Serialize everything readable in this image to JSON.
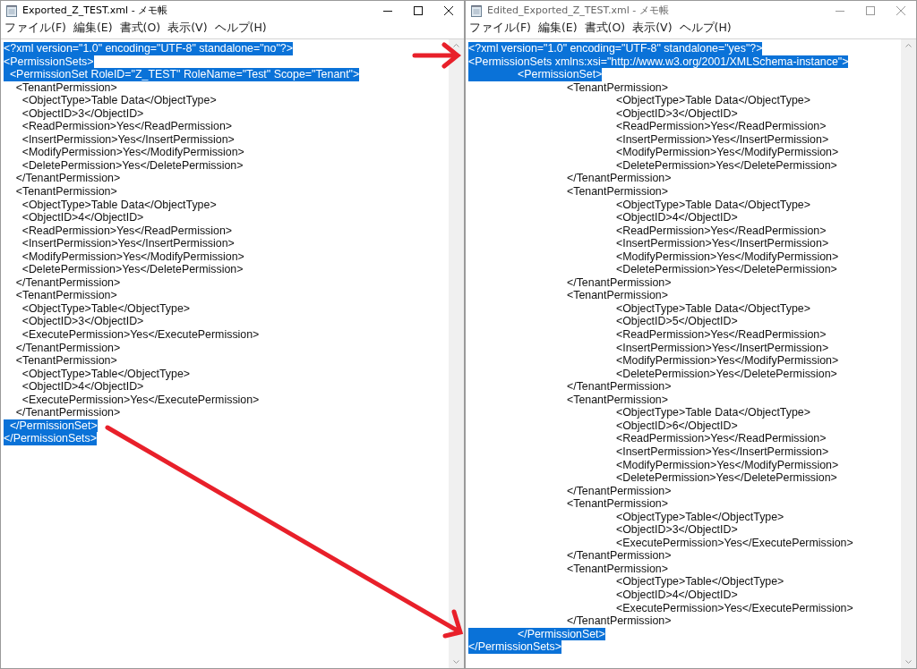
{
  "windows": [
    {
      "title": "Exported_Z_TEST.xml - メモ帳",
      "active": true,
      "menu": [
        "ファイル(F)",
        "編集(E)",
        "書式(O)",
        "表示(V)",
        "ヘルプ(H)"
      ],
      "lines": [
        {
          "text": "<?xml version=\"1.0\" encoding=\"UTF-8\" standalone=\"no\"?>",
          "selected": true
        },
        {
          "text": "<PermissionSets>",
          "selected": true
        },
        {
          "text": "  <PermissionSet RoleID=\"Z_TEST\" RoleName=\"Test\" Scope=\"Tenant\">",
          "selected": true
        },
        {
          "text": "    <TenantPermission>",
          "selected": false
        },
        {
          "text": "      <ObjectType>Table Data</ObjectType>",
          "selected": false
        },
        {
          "text": "      <ObjectID>3</ObjectID>",
          "selected": false
        },
        {
          "text": "      <ReadPermission>Yes</ReadPermission>",
          "selected": false
        },
        {
          "text": "      <InsertPermission>Yes</InsertPermission>",
          "selected": false
        },
        {
          "text": "      <ModifyPermission>Yes</ModifyPermission>",
          "selected": false
        },
        {
          "text": "      <DeletePermission>Yes</DeletePermission>",
          "selected": false
        },
        {
          "text": "    </TenantPermission>",
          "selected": false
        },
        {
          "text": "    <TenantPermission>",
          "selected": false
        },
        {
          "text": "      <ObjectType>Table Data</ObjectType>",
          "selected": false
        },
        {
          "text": "      <ObjectID>4</ObjectID>",
          "selected": false
        },
        {
          "text": "      <ReadPermission>Yes</ReadPermission>",
          "selected": false
        },
        {
          "text": "      <InsertPermission>Yes</InsertPermission>",
          "selected": false
        },
        {
          "text": "      <ModifyPermission>Yes</ModifyPermission>",
          "selected": false
        },
        {
          "text": "      <DeletePermission>Yes</DeletePermission>",
          "selected": false
        },
        {
          "text": "    </TenantPermission>",
          "selected": false
        },
        {
          "text": "    <TenantPermission>",
          "selected": false
        },
        {
          "text": "      <ObjectType>Table</ObjectType>",
          "selected": false
        },
        {
          "text": "      <ObjectID>3</ObjectID>",
          "selected": false
        },
        {
          "text": "      <ExecutePermission>Yes</ExecutePermission>",
          "selected": false
        },
        {
          "text": "    </TenantPermission>",
          "selected": false
        },
        {
          "text": "    <TenantPermission>",
          "selected": false
        },
        {
          "text": "      <ObjectType>Table</ObjectType>",
          "selected": false
        },
        {
          "text": "      <ObjectID>4</ObjectID>",
          "selected": false
        },
        {
          "text": "      <ExecutePermission>Yes</ExecutePermission>",
          "selected": false
        },
        {
          "text": "    </TenantPermission>",
          "selected": false
        },
        {
          "text": "  </PermissionSet>",
          "selected": true
        },
        {
          "text": "</PermissionSets>",
          "selected": true
        }
      ]
    },
    {
      "title": "Edited_Exported_Z_TEST.xml - メモ帳",
      "active": false,
      "menu": [
        "ファイル(F)",
        "編集(E)",
        "書式(O)",
        "表示(V)",
        "ヘルプ(H)"
      ],
      "lines": [
        {
          "text": "<?xml version=\"1.0\" encoding=\"UTF-8\" standalone=\"yes\"?>",
          "selected": true
        },
        {
          "text": "<PermissionSets xmlns:xsi=\"http://www.w3.org/2001/XMLSchema-instance\">",
          "selected": true
        },
        {
          "text": "\t<PermissionSet>",
          "selected": true
        },
        {
          "text": "\t\t<TenantPermission>",
          "selected": false
        },
        {
          "text": "\t\t\t<ObjectType>Table Data</ObjectType>",
          "selected": false
        },
        {
          "text": "\t\t\t<ObjectID>3</ObjectID>",
          "selected": false
        },
        {
          "text": "\t\t\t<ReadPermission>Yes</ReadPermission>",
          "selected": false
        },
        {
          "text": "\t\t\t<InsertPermission>Yes</InsertPermission>",
          "selected": false
        },
        {
          "text": "\t\t\t<ModifyPermission>Yes</ModifyPermission>",
          "selected": false
        },
        {
          "text": "\t\t\t<DeletePermission>Yes</DeletePermission>",
          "selected": false
        },
        {
          "text": "\t\t</TenantPermission>",
          "selected": false
        },
        {
          "text": "\t\t<TenantPermission>",
          "selected": false
        },
        {
          "text": "\t\t\t<ObjectType>Table Data</ObjectType>",
          "selected": false
        },
        {
          "text": "\t\t\t<ObjectID>4</ObjectID>",
          "selected": false
        },
        {
          "text": "\t\t\t<ReadPermission>Yes</ReadPermission>",
          "selected": false
        },
        {
          "text": "\t\t\t<InsertPermission>Yes</InsertPermission>",
          "selected": false
        },
        {
          "text": "\t\t\t<ModifyPermission>Yes</ModifyPermission>",
          "selected": false
        },
        {
          "text": "\t\t\t<DeletePermission>Yes</DeletePermission>",
          "selected": false
        },
        {
          "text": "\t\t</TenantPermission>",
          "selected": false
        },
        {
          "text": "\t\t<TenantPermission>",
          "selected": false
        },
        {
          "text": "\t\t\t<ObjectType>Table Data</ObjectType>",
          "selected": false
        },
        {
          "text": "\t\t\t<ObjectID>5</ObjectID>",
          "selected": false
        },
        {
          "text": "\t\t\t<ReadPermission>Yes</ReadPermission>",
          "selected": false
        },
        {
          "text": "\t\t\t<InsertPermission>Yes</InsertPermission>",
          "selected": false
        },
        {
          "text": "\t\t\t<ModifyPermission>Yes</ModifyPermission>",
          "selected": false
        },
        {
          "text": "\t\t\t<DeletePermission>Yes</DeletePermission>",
          "selected": false
        },
        {
          "text": "\t\t</TenantPermission>",
          "selected": false
        },
        {
          "text": "\t\t<TenantPermission>",
          "selected": false
        },
        {
          "text": "\t\t\t<ObjectType>Table Data</ObjectType>",
          "selected": false
        },
        {
          "text": "\t\t\t<ObjectID>6</ObjectID>",
          "selected": false
        },
        {
          "text": "\t\t\t<ReadPermission>Yes</ReadPermission>",
          "selected": false
        },
        {
          "text": "\t\t\t<InsertPermission>Yes</InsertPermission>",
          "selected": false
        },
        {
          "text": "\t\t\t<ModifyPermission>Yes</ModifyPermission>",
          "selected": false
        },
        {
          "text": "\t\t\t<DeletePermission>Yes</DeletePermission>",
          "selected": false
        },
        {
          "text": "\t\t</TenantPermission>",
          "selected": false
        },
        {
          "text": "\t\t<TenantPermission>",
          "selected": false
        },
        {
          "text": "\t\t\t<ObjectType>Table</ObjectType>",
          "selected": false
        },
        {
          "text": "\t\t\t<ObjectID>3</ObjectID>",
          "selected": false
        },
        {
          "text": "\t\t\t<ExecutePermission>Yes</ExecutePermission>",
          "selected": false
        },
        {
          "text": "\t\t</TenantPermission>",
          "selected": false
        },
        {
          "text": "\t\t<TenantPermission>",
          "selected": false
        },
        {
          "text": "\t\t\t<ObjectType>Table</ObjectType>",
          "selected": false
        },
        {
          "text": "\t\t\t<ObjectID>4</ObjectID>",
          "selected": false
        },
        {
          "text": "\t\t\t<ExecutePermission>Yes</ExecutePermission>",
          "selected": false
        },
        {
          "text": "\t\t</TenantPermission>",
          "selected": false
        },
        {
          "text": "\t</PermissionSet>",
          "selected": true
        },
        {
          "text": "</PermissionSets>",
          "selected": true
        }
      ]
    }
  ]
}
